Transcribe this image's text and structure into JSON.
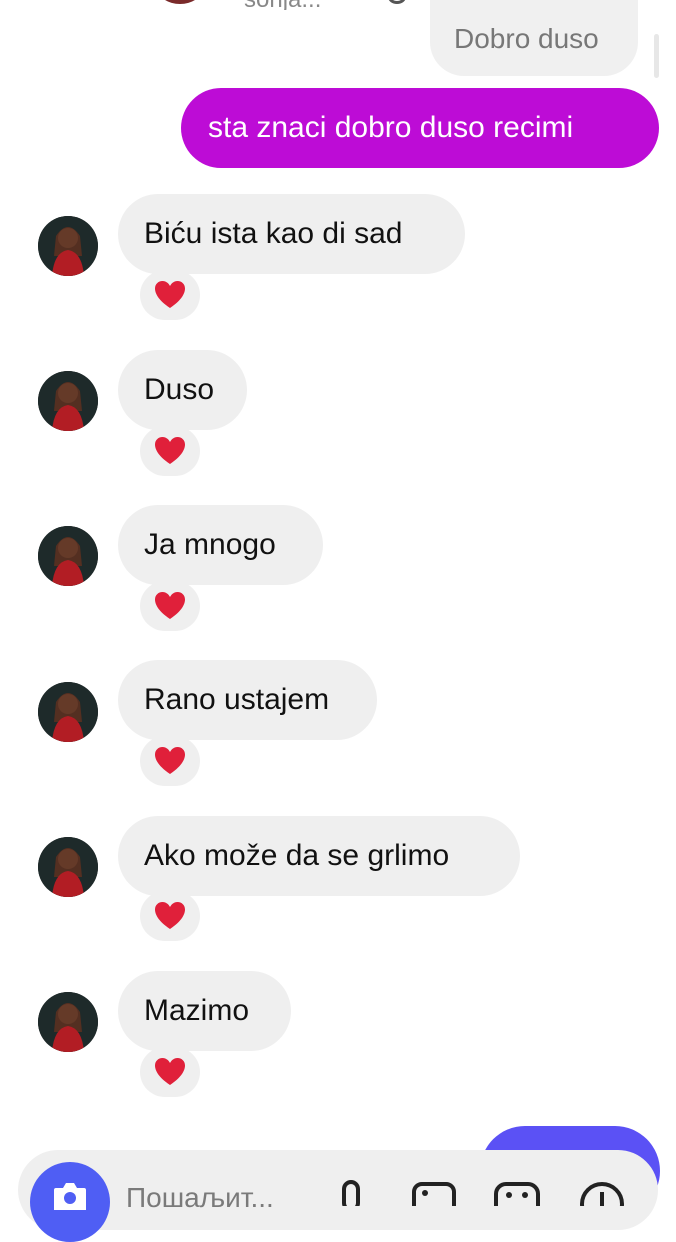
{
  "header": {
    "contact_name": "sonja..."
  },
  "messages": {
    "previous": {
      "text": "Dobro duso"
    },
    "sent": {
      "text": "sta znaci dobro duso recimi"
    },
    "received": [
      {
        "text": "Biću ista kao di sad",
        "reaction": "❤️"
      },
      {
        "text": "Duso",
        "reaction": "❤️"
      },
      {
        "text": "Ja mnogo",
        "reaction": "❤️"
      },
      {
        "text": "Rano ustajem",
        "reaction": "❤️"
      },
      {
        "text": "Ako može da se grlimo",
        "reaction": "❤️"
      },
      {
        "text": "Mazimo",
        "reaction": "❤️"
      }
    ]
  },
  "composer": {
    "placeholder": "Пошаљит...",
    "icons": [
      "camera-icon",
      "microphone-icon",
      "gallery-icon",
      "sticker-icon",
      "add-icon"
    ]
  },
  "colors": {
    "sent_bubble": "#bd0cd6",
    "received_bubble": "#efefef",
    "camera_button": "#4f5ef4",
    "send_button": "#5b51f5"
  }
}
